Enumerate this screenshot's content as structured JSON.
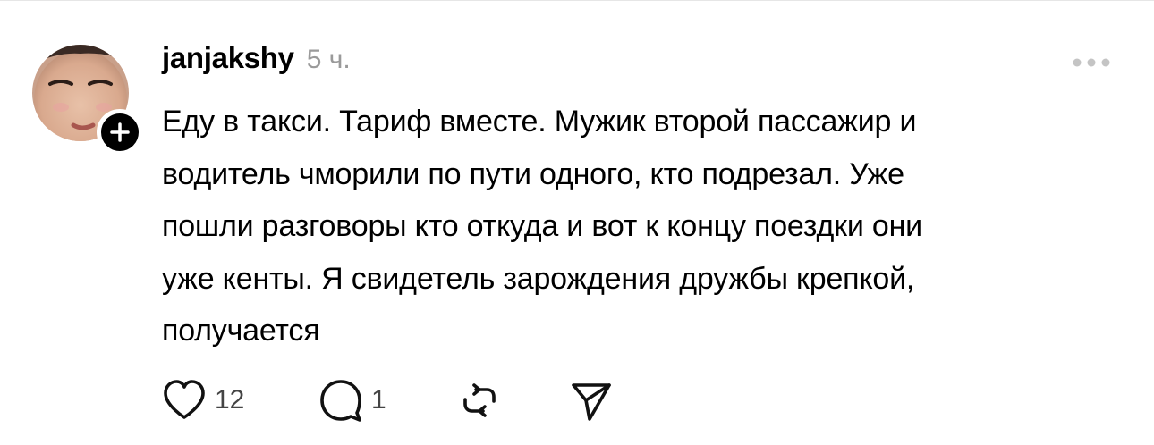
{
  "post": {
    "username": "janjakshy",
    "time": "5 ч.",
    "text": "Еду в такси. Тариф вместе. Мужик второй пассажир и\nводитель чморили по пути одного, кто подрезал. Уже\nпошли разговоры кто откуда и вот к концу поездки они\nуже кенты. Я свидетель зарождения дружбы крепкой,\nполучается"
  },
  "actions": {
    "likes": "12",
    "replies": "1"
  },
  "icons": {
    "like": "heart-icon",
    "reply": "comment-bubble-icon",
    "repost": "repost-icon",
    "share": "send-icon",
    "more": "more-horizontal-icon",
    "follow": "plus-icon"
  },
  "colors": {
    "text": "#000000",
    "muted": "#9a9a9a",
    "badge": "#000000"
  }
}
